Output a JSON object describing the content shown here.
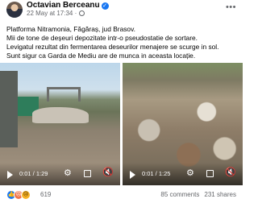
{
  "post": {
    "author": "Octavian Berceanu",
    "timestamp": "22 May at 17:34",
    "text_lines": [
      "Platforma Nitramonia, Făgăraș, jud Brasov.",
      "Mii de tone de deșeuri depozitate intr-o pseudostatie de sortare.",
      "Levigatul rezultat din fermentarea deseurilor menajere se scurge in sol.",
      "Sunt sigur ca Garda de Mediu are de munca in aceasta locație."
    ]
  },
  "videos": [
    {
      "time": "0:01 / 1:29"
    },
    {
      "time": "0:01 / 1:25"
    }
  ],
  "footer": {
    "reaction_count": "619",
    "comments": "85 comments",
    "shares": "231 shares"
  },
  "colors": {
    "link_blue": "#1877f2",
    "secondary_text": "#65676b"
  }
}
